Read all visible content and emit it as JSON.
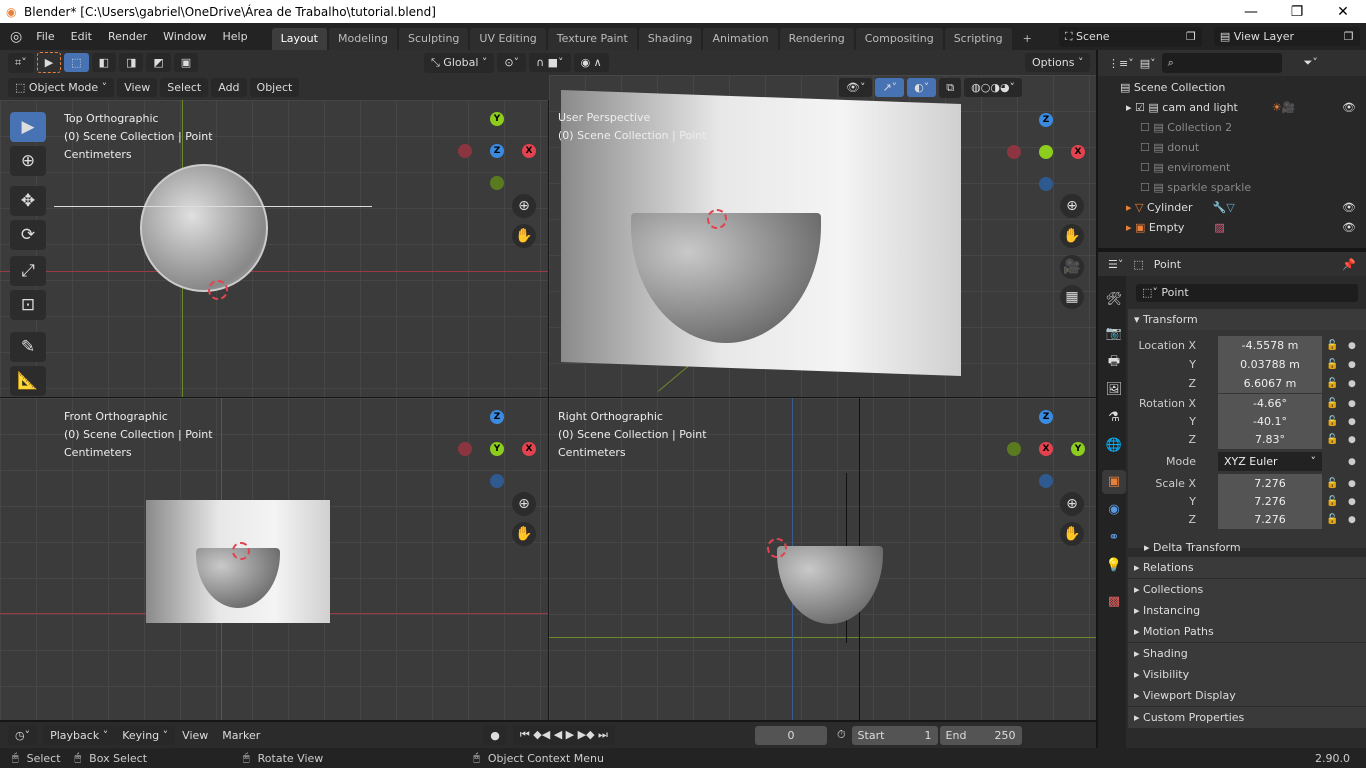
{
  "window": {
    "title": "Blender* [C:\\Users\\gabriel\\OneDrive\\Área de Trabalho\\tutorial.blend]",
    "minimize": "—",
    "maximize": "❐",
    "close": "✕"
  },
  "menu": [
    "File",
    "Edit",
    "Render",
    "Window",
    "Help"
  ],
  "workspaces": [
    "Layout",
    "Modeling",
    "Sculpting",
    "UV Editing",
    "Texture Paint",
    "Shading",
    "Animation",
    "Rendering",
    "Compositing",
    "Scripting",
    "+"
  ],
  "scene": "Scene",
  "view_layer": "View Layer",
  "viewport_header": {
    "mode": "Object Mode",
    "menus": [
      "View",
      "Select",
      "Add",
      "Object"
    ],
    "orientation": "Global",
    "options": "Options"
  },
  "viewports": [
    {
      "name": "Top Orthographic",
      "collection": "(0) Scene Collection | Point",
      "units": "Centimeters"
    },
    {
      "name": "User Perspective",
      "collection": "(0) Scene Collection | Point",
      "units": ""
    },
    {
      "name": "Front Orthographic",
      "collection": "(0) Scene Collection | Point",
      "units": "Centimeters"
    },
    {
      "name": "Right Orthographic",
      "collection": "(0) Scene Collection | Point",
      "units": "Centimeters"
    }
  ],
  "axes": {
    "x": "X",
    "y": "Y",
    "z": "Z",
    "colors": {
      "x": "#e2434f",
      "y": "#8ccd1e",
      "z": "#3a8ae0"
    }
  },
  "outliner": {
    "root": "Scene Collection",
    "items": [
      {
        "label": "cam and light",
        "checked": true,
        "dim": false
      },
      {
        "label": "Collection 2",
        "checked": false,
        "dim": true
      },
      {
        "label": "donut",
        "checked": false,
        "dim": true
      },
      {
        "label": "enviroment",
        "checked": false,
        "dim": true
      },
      {
        "label": "sparkle sparkle",
        "checked": false,
        "dim": true
      },
      {
        "label": "Cylinder",
        "checked": false,
        "dim": false
      },
      {
        "label": "Empty",
        "checked": false,
        "dim": false
      }
    ]
  },
  "properties": {
    "object": "Point",
    "name_field": "Point",
    "transform": "Transform",
    "location": {
      "label": "Location X",
      "x": "-4.5578 m",
      "y": "0.03788 m",
      "z": "6.6067 m"
    },
    "rotation": {
      "label": "Rotation X",
      "x": "-4.66°",
      "y": "-40.1°",
      "z": "7.83°"
    },
    "mode_label": "Mode",
    "mode": "XYZ Euler",
    "scale": {
      "label": "Scale X",
      "x": "7.276",
      "y": "7.276",
      "z": "7.276"
    },
    "y_label": "Y",
    "z_label": "Z",
    "delta": "Delta Transform",
    "sections": [
      "Relations",
      "Collections",
      "Instancing",
      "Motion Paths",
      "Shading",
      "Visibility",
      "Viewport Display",
      "Custom Properties"
    ]
  },
  "timeline": {
    "menus": [
      "Playback",
      "Keying",
      "View",
      "Marker"
    ],
    "current_frame": "0",
    "start_label": "Start",
    "start": "1",
    "end_label": "End",
    "end": "250"
  },
  "status": {
    "select": "Select",
    "box_select": "Box Select",
    "rotate": "Rotate View",
    "context": "Object Context Menu",
    "version": "2.90.0"
  },
  "accent": "#4772b3",
  "active_orange": "#e8803a"
}
